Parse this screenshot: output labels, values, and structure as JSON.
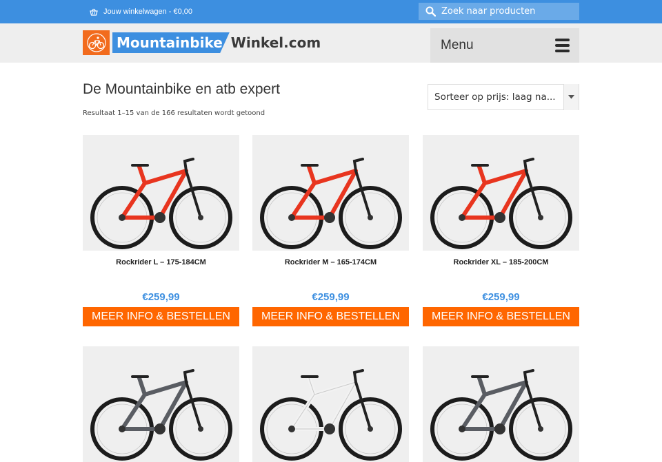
{
  "topbar": {
    "cart_label": "Jouw winkelwagen - €0,00",
    "cart_icon": "basket-icon",
    "search_placeholder": "Zoek naar producten",
    "search_icon": "search-icon"
  },
  "header": {
    "logo_part1": "Mountainbike",
    "logo_part2": "Winkel.com",
    "menu_label": "Menu",
    "menu_icon": "hamburger-icon"
  },
  "catalog": {
    "title": "De Mountainbike en atb expert",
    "result_count": "Resultaat 1–15 van de 166 resultaten wordt getoond",
    "sort_value": "Sorteer op prijs: laag na..."
  },
  "products": [
    {
      "name": "Rockrider L – 175-184CM",
      "price": "€259,99",
      "button": "MEER INFO & BESTELLEN",
      "frame_color": "#e8351f"
    },
    {
      "name": "Rockrider M – 165-174CM",
      "price": "€259,99",
      "button": "MEER INFO & BESTELLEN",
      "frame_color": "#e8351f"
    },
    {
      "name": "Rockrider XL – 185-200CM",
      "price": "€259,99",
      "button": "MEER INFO & BESTELLEN",
      "frame_color": "#e8351f"
    },
    {
      "frame_color": "#5a5d63"
    },
    {
      "frame_color": "#f2f2f2"
    },
    {
      "frame_color": "#5a5d63"
    }
  ],
  "colors": {
    "accent_blue": "#3d8fe0",
    "button_orange": "#ff6600",
    "logo_orange": "#f26b1d"
  }
}
